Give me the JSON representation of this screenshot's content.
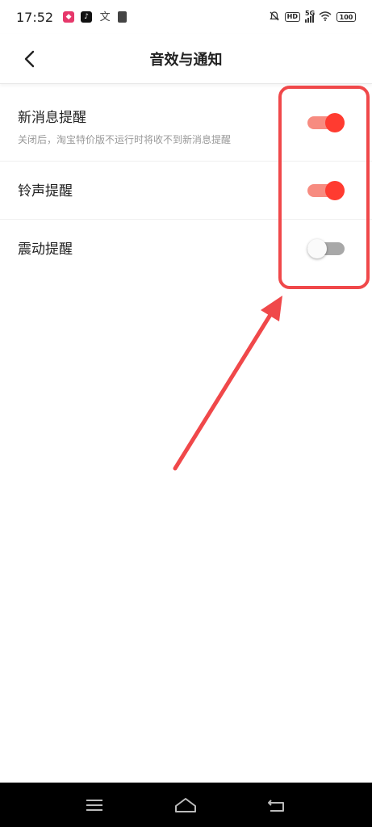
{
  "status_bar": {
    "time": "17:52",
    "app_icons": [
      "pinduoduo-icon",
      "tiktok-icon",
      "translate-icon",
      "clipboard-icon"
    ],
    "hd_label": "HD",
    "network_label": "5G",
    "battery_label": "100"
  },
  "header": {
    "title": "音效与通知"
  },
  "settings": {
    "new_message": {
      "label": "新消息提醒",
      "description": "关闭后，淘宝特价版不运行时将收不到新消息提醒",
      "enabled": true
    },
    "ringtone": {
      "label": "铃声提醒",
      "enabled": true
    },
    "vibration": {
      "label": "震动提醒",
      "enabled": false
    }
  },
  "colors": {
    "toggle_on_thumb": "#ff3b30",
    "toggle_on_track": "#f78b80",
    "toggle_off_track": "#a8a8a8",
    "annotation": "#f0484a"
  }
}
